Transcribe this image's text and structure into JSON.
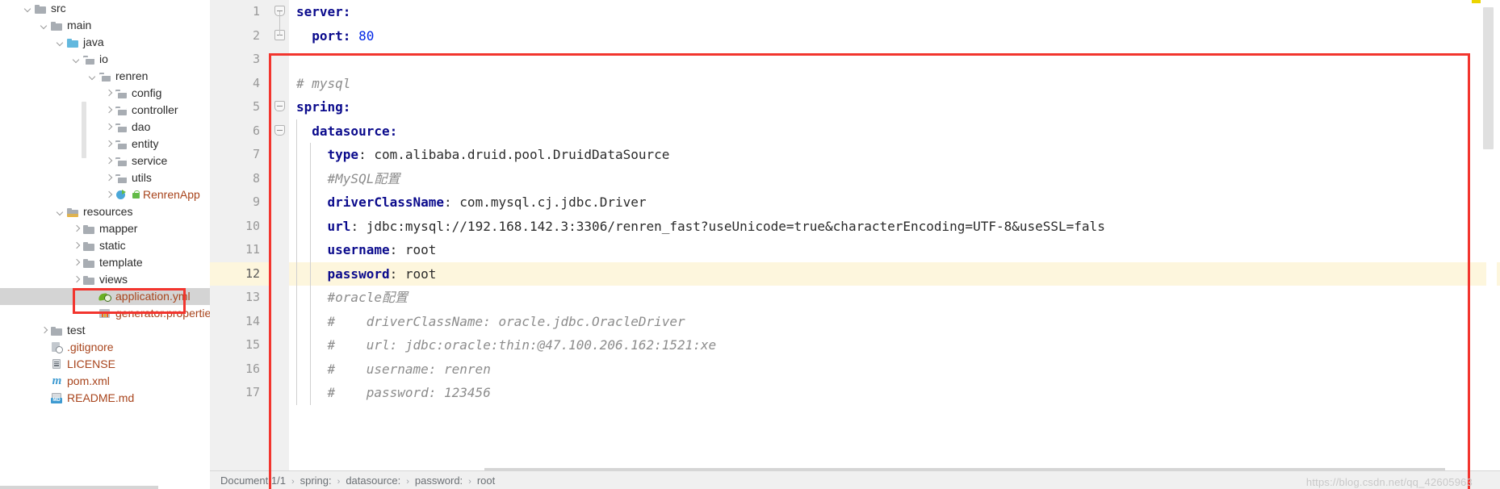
{
  "project_tree": {
    "items": [
      {
        "label": "src",
        "indent": 1,
        "arrow": "expanded",
        "icon": "folder",
        "style": "plain"
      },
      {
        "label": "main",
        "indent": 2,
        "arrow": "expanded",
        "icon": "folder",
        "style": "plain"
      },
      {
        "label": "java",
        "indent": 3,
        "arrow": "expanded",
        "icon": "folder-src",
        "style": "plain"
      },
      {
        "label": "io",
        "indent": 4,
        "arrow": "expanded",
        "icon": "folder-pkg",
        "style": "plain"
      },
      {
        "label": "renren",
        "indent": 5,
        "arrow": "expanded",
        "icon": "folder-pkg",
        "style": "plain"
      },
      {
        "label": "config",
        "indent": 6,
        "arrow": "collapsed",
        "icon": "folder-pkg",
        "style": "plain"
      },
      {
        "label": "controller",
        "indent": 6,
        "arrow": "collapsed",
        "icon": "folder-pkg",
        "style": "plain"
      },
      {
        "label": "dao",
        "indent": 6,
        "arrow": "collapsed",
        "icon": "folder-pkg",
        "style": "plain"
      },
      {
        "label": "entity",
        "indent": 6,
        "arrow": "collapsed",
        "icon": "folder-pkg",
        "style": "plain"
      },
      {
        "label": "service",
        "indent": 6,
        "arrow": "collapsed",
        "icon": "folder-pkg",
        "style": "plain"
      },
      {
        "label": "utils",
        "indent": 6,
        "arrow": "collapsed",
        "icon": "folder-pkg",
        "style": "plain"
      },
      {
        "label": "RenrenApp",
        "indent": 6,
        "arrow": "collapsed",
        "icon": "springapp",
        "style": "classname",
        "run_mark": true
      },
      {
        "label": "resources",
        "indent": 3,
        "arrow": "expanded",
        "icon": "folder-res",
        "style": "plain"
      },
      {
        "label": "mapper",
        "indent": 4,
        "arrow": "collapsed",
        "icon": "folder",
        "style": "plain"
      },
      {
        "label": "static",
        "indent": 4,
        "arrow": "collapsed",
        "icon": "folder",
        "style": "plain"
      },
      {
        "label": "template",
        "indent": 4,
        "arrow": "collapsed",
        "icon": "folder",
        "style": "plain"
      },
      {
        "label": "views",
        "indent": 4,
        "arrow": "collapsed",
        "icon": "folder",
        "style": "plain"
      },
      {
        "label": "application.yml",
        "indent": 5,
        "arrow": "none",
        "icon": "yml",
        "style": "file",
        "selected": true
      },
      {
        "label": "generator.propertie",
        "indent": 5,
        "arrow": "none",
        "icon": "props",
        "style": "file"
      },
      {
        "label": "test",
        "indent": 2,
        "arrow": "collapsed",
        "icon": "folder",
        "style": "plain"
      },
      {
        "label": ".gitignore",
        "indent": 2,
        "arrow": "none",
        "icon": "gitign",
        "style": "file"
      },
      {
        "label": "LICENSE",
        "indent": 2,
        "arrow": "none",
        "icon": "doc",
        "style": "file"
      },
      {
        "label": "pom.xml",
        "indent": 2,
        "arrow": "none",
        "icon": "maven",
        "style": "file"
      },
      {
        "label": "README.md",
        "indent": 2,
        "arrow": "none",
        "icon": "md",
        "style": "file"
      }
    ]
  },
  "editor": {
    "current_line": 12,
    "lines": [
      {
        "n": 1,
        "fold": "top",
        "tokens": [
          {
            "t": "server:",
            "c": "k"
          }
        ]
      },
      {
        "n": 2,
        "fold": "mid",
        "tokens": [
          {
            "t": "  port: ",
            "c": "k"
          },
          {
            "t": "80",
            "c": "num"
          }
        ]
      },
      {
        "n": 3,
        "fold": "none",
        "tokens": []
      },
      {
        "n": 4,
        "fold": "none",
        "tokens": [
          {
            "t": "# mysql",
            "c": "cm"
          }
        ]
      },
      {
        "n": 5,
        "fold": "top",
        "tokens": [
          {
            "t": "spring:",
            "c": "k"
          }
        ]
      },
      {
        "n": 6,
        "fold": "top",
        "tokens": [
          {
            "t": "  datasource:",
            "c": "k"
          }
        ]
      },
      {
        "n": 7,
        "fold": "none",
        "tokens": [
          {
            "t": "    type",
            "c": "k"
          },
          {
            "t": ": com.alibaba.druid.pool.DruidDataSource",
            "c": "v"
          }
        ]
      },
      {
        "n": 8,
        "fold": "none",
        "tokens": [
          {
            "t": "    #MySQL配置",
            "c": "cm"
          }
        ]
      },
      {
        "n": 9,
        "fold": "none",
        "tokens": [
          {
            "t": "    driverClassName",
            "c": "k"
          },
          {
            "t": ": com.mysql.cj.jdbc.Driver",
            "c": "v"
          }
        ]
      },
      {
        "n": 10,
        "fold": "none",
        "tokens": [
          {
            "t": "    url",
            "c": "k"
          },
          {
            "t": ": jdbc:mysql://192.168.142.3:3306/renren_fast?useUnicode=true&characterEncoding=UTF-8&useSSL=fals",
            "c": "v"
          }
        ]
      },
      {
        "n": 11,
        "fold": "none",
        "tokens": [
          {
            "t": "    username",
            "c": "k"
          },
          {
            "t": ": root",
            "c": "v"
          }
        ]
      },
      {
        "n": 12,
        "fold": "none",
        "tokens": [
          {
            "t": "    password",
            "c": "k"
          },
          {
            "t": ": root",
            "c": "v"
          }
        ]
      },
      {
        "n": 13,
        "fold": "none",
        "tokens": [
          {
            "t": "    #oracle配置",
            "c": "cm"
          }
        ]
      },
      {
        "n": 14,
        "fold": "none",
        "tokens": [
          {
            "t": "    #    driverClassName: oracle.jdbc.OracleDriver",
            "c": "cm"
          }
        ]
      },
      {
        "n": 15,
        "fold": "none",
        "tokens": [
          {
            "t": "    #    url: jdbc:oracle:thin:@47.100.206.162:1521:xe",
            "c": "cm"
          }
        ]
      },
      {
        "n": 16,
        "fold": "none",
        "tokens": [
          {
            "t": "    #    username: renren",
            "c": "cm"
          }
        ]
      },
      {
        "n": 17,
        "fold": "none",
        "tokens": [
          {
            "t": "    #    password: 123456",
            "c": "cm"
          }
        ]
      }
    ]
  },
  "breadcrumb": {
    "crumbs": [
      "Document 1/1",
      "spring:",
      "datasource:",
      "password:",
      "root"
    ],
    "separator": "›"
  },
  "watermark": {
    "text": "https://blog.csdn.net/qq_42605963"
  },
  "colors": {
    "annotation_red": "#f2352e",
    "key_blue": "#0a0a8c",
    "number_blue": "#0026e6",
    "comment_gray": "#8c8c8c",
    "selection_gray": "#d4d4d4",
    "current_line_yellow": "#fdf6dd",
    "marker_yellow": "#ebd400",
    "file_orange": "#a8441c"
  }
}
